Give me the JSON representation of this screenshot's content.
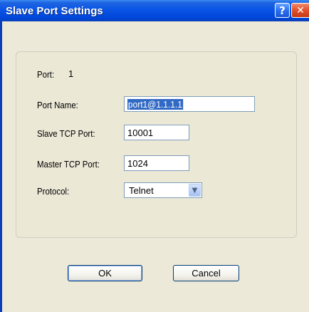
{
  "window": {
    "title": "Slave Port Settings",
    "help_glyph": "?",
    "close_glyph": "✕"
  },
  "form": {
    "port_label": "Port:",
    "port_value": "1",
    "port_name_label": "Port Name:",
    "port_name_value": "port1@1.1.1.1",
    "slave_tcp_label": "Slave TCP Port:",
    "slave_tcp_value": "10001",
    "master_tcp_label": "Master TCP Port:",
    "master_tcp_value": "1024",
    "protocol_label": "Protocol:",
    "protocol_value": "Telnet"
  },
  "buttons": {
    "ok": "OK",
    "cancel": "Cancel"
  },
  "icons": {
    "help": "help-icon",
    "close": "close-icon",
    "dropdown": "chevron-down-icon"
  },
  "colors": {
    "titlebar": "#0a54e6",
    "selection": "#316ac5",
    "dialog_bg": "#ece9d8"
  }
}
